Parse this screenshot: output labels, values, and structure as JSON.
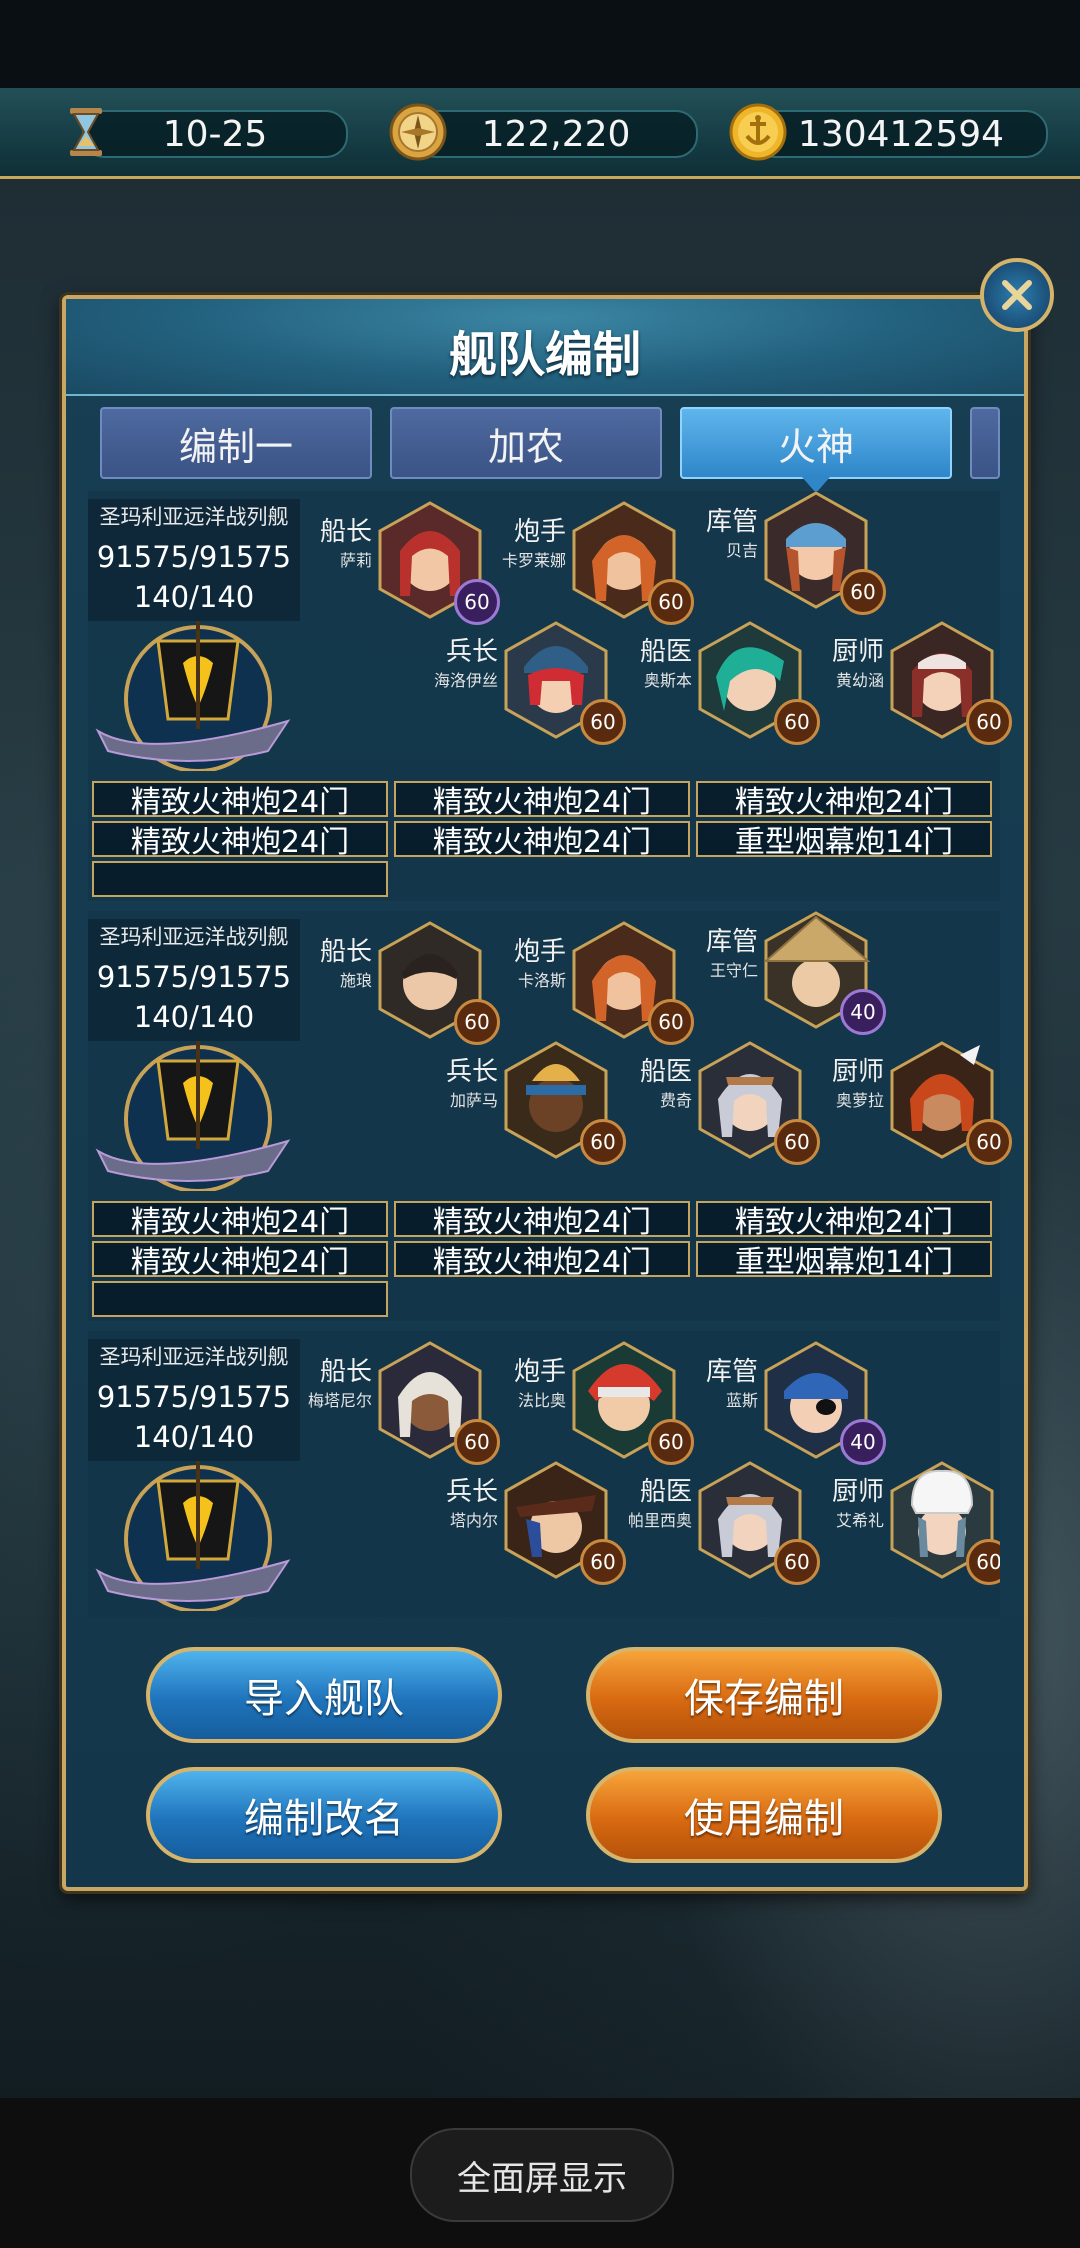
{
  "resources": [
    {
      "icon": "hourglass-icon",
      "value": "10-25"
    },
    {
      "icon": "compass-icon",
      "value": "122,220"
    },
    {
      "icon": "gold-anchor-coin-icon",
      "value": "130412594"
    }
  ],
  "panel": {
    "title": "舰队编制",
    "tabs": [
      {
        "label": "编制一",
        "active": false
      },
      {
        "label": "加农",
        "active": false
      },
      {
        "label": "火神",
        "active": true
      }
    ]
  },
  "fleets": [
    {
      "ship_name": "圣玛利亚远洋战列舰",
      "hp": "91575/91575",
      "sailors": "140/140",
      "officers": [
        {
          "role": "船长",
          "name": "萨莉",
          "level": "60"
        },
        {
          "role": "炮手",
          "name": "卡罗莱娜",
          "level": "60"
        },
        {
          "role": "库管",
          "name": "贝吉",
          "level": "60"
        },
        {
          "role": "兵长",
          "name": "海洛伊丝",
          "level": "60"
        },
        {
          "role": "船医",
          "name": "奥斯本",
          "level": "60"
        },
        {
          "role": "厨师",
          "name": "黄幼涵",
          "level": "60"
        }
      ],
      "cannons": [
        "精致火神炮24门",
        "精致火神炮24门",
        "精致火神炮24门",
        "精致火神炮24门",
        "精致火神炮24门",
        "重型烟幕炮14门"
      ]
    },
    {
      "ship_name": "圣玛利亚远洋战列舰",
      "hp": "91575/91575",
      "sailors": "140/140",
      "officers": [
        {
          "role": "船长",
          "name": "施琅",
          "level": "60"
        },
        {
          "role": "炮手",
          "name": "卡洛斯",
          "level": "60"
        },
        {
          "role": "库管",
          "name": "王守仁",
          "level": "40"
        },
        {
          "role": "兵长",
          "name": "加萨马",
          "level": "60"
        },
        {
          "role": "船医",
          "name": "费奇",
          "level": "60"
        },
        {
          "role": "厨师",
          "name": "奥萝拉",
          "level": "60"
        }
      ],
      "cannons": [
        "精致火神炮24门",
        "精致火神炮24门",
        "精致火神炮24门",
        "精致火神炮24门",
        "精致火神炮24门",
        "重型烟幕炮14门"
      ]
    },
    {
      "ship_name": "圣玛利亚远洋战列舰",
      "hp": "91575/91575",
      "sailors": "140/140",
      "officers": [
        {
          "role": "船长",
          "name": "梅塔尼尔",
          "level": "60"
        },
        {
          "role": "炮手",
          "name": "法比奥",
          "level": "60"
        },
        {
          "role": "库管",
          "name": "蓝斯",
          "level": "40"
        },
        {
          "role": "兵长",
          "name": "塔内尔",
          "level": "60"
        },
        {
          "role": "船医",
          "name": "帕里西奥",
          "level": "60"
        },
        {
          "role": "厨师",
          "name": "艾希礼",
          "level": "60"
        }
      ]
    }
  ],
  "buttons": {
    "import_fleet": "导入舰队",
    "save_formation": "保存编制",
    "rename_formation": "编制改名",
    "use_formation": "使用编制"
  },
  "system": {
    "fullscreen_label": "全面屏显示"
  },
  "colors": {
    "panel_border": "#c9a662",
    "tab_active": "#2f86c9",
    "button_blue": "#1f74bb",
    "button_orange": "#d86a11",
    "level_badge_purple": "#3a1f5e"
  }
}
